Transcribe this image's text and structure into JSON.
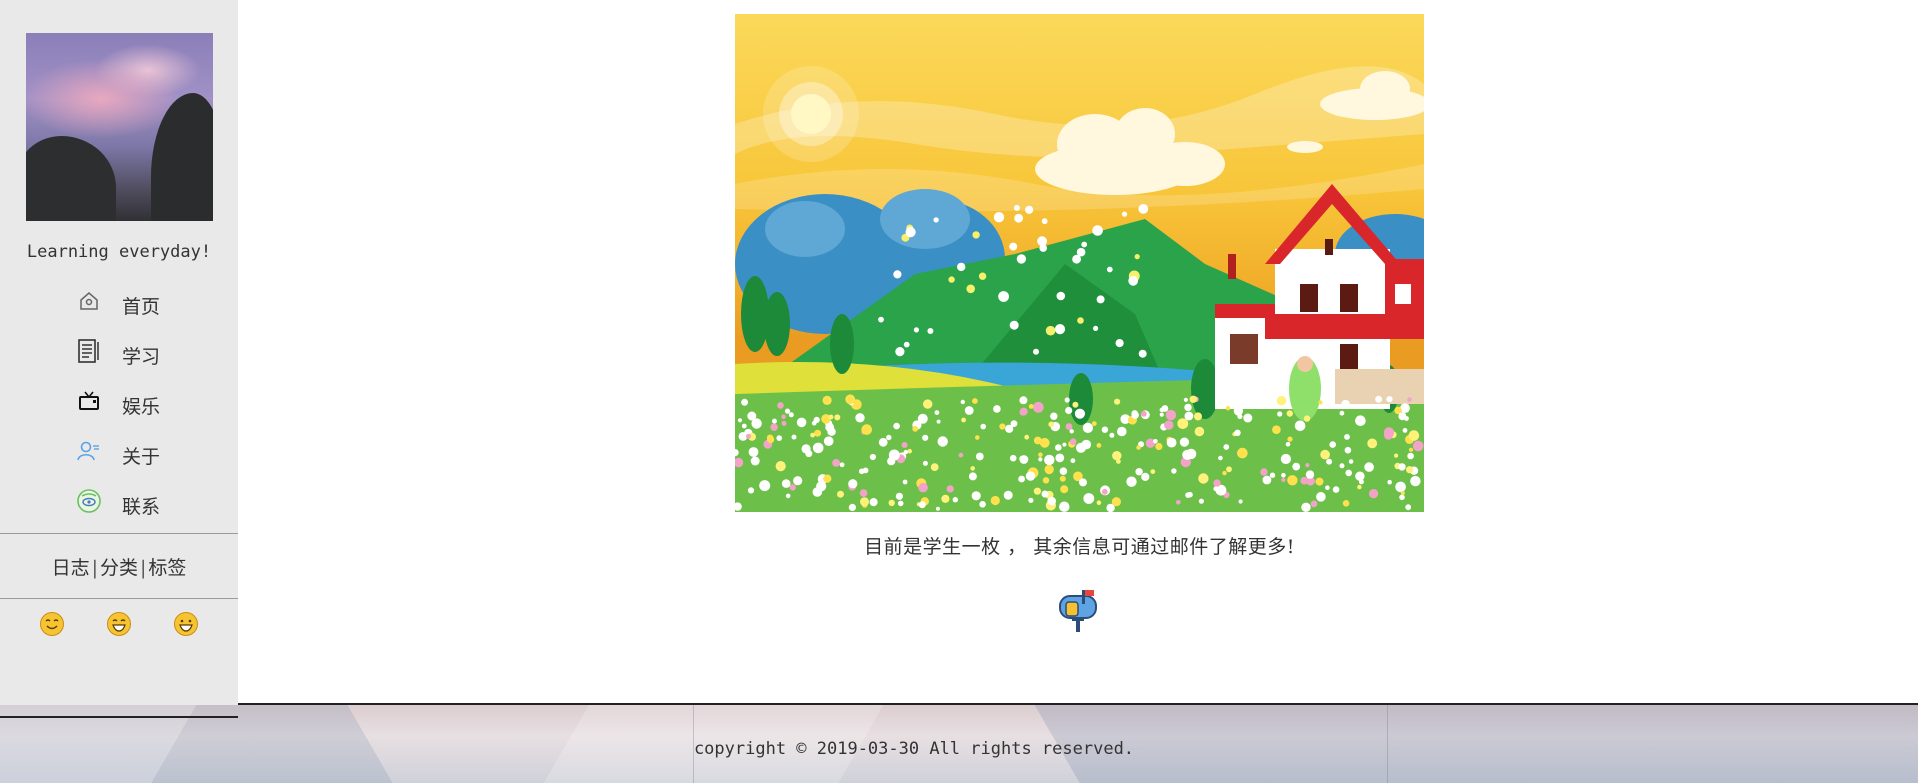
{
  "sidebar": {
    "motto": "Learning everyday!",
    "nav": [
      {
        "label": "首页",
        "icon": "home-icon"
      },
      {
        "label": "学习",
        "icon": "book-icon"
      },
      {
        "label": "娱乐",
        "icon": "tv-icon"
      },
      {
        "label": "关于",
        "icon": "user-icon"
      },
      {
        "label": "联系",
        "icon": "contact-icon"
      }
    ],
    "links": {
      "log": "日志",
      "category": "分类",
      "tag": "标签",
      "separator": "|"
    },
    "emojis": [
      "smile-emoji-icon",
      "grin-emoji-icon",
      "laugh-emoji-icon"
    ]
  },
  "main": {
    "caption": "目前是学生一枚 ， 其余信息可通过邮件了解更多!",
    "mailbox_icon": "mailbox-icon"
  },
  "footer": {
    "copyright": "copyright © 2019-03-30 All rights reserved."
  },
  "colors": {
    "sidebar_bg": "#e9e9e9",
    "text": "#333333"
  }
}
